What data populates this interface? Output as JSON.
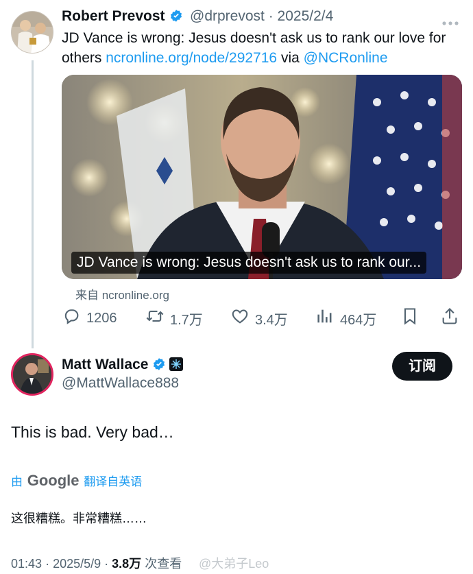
{
  "tweet1": {
    "author_name": "Robert Prevost",
    "handle": "@drprevost",
    "separator": "·",
    "date": "2025/2/4",
    "text_line1": "JD Vance is wrong: Jesus doesn't ask us to rank our love for",
    "text_line2_prefix": "others",
    "link": "ncronline.org/node/292716",
    "via_word": "via",
    "mention": "@NCRonline",
    "media_caption": "JD Vance is wrong: Jesus doesn't ask us to rank our...",
    "from_label": "来自 ncronline.org",
    "stats": {
      "replies": "1206",
      "reposts": "1.7万",
      "likes": "3.4万",
      "views": "464万"
    }
  },
  "tweet2": {
    "author_name": "Matt Wallace",
    "handle": "@MattWallace888",
    "subscribe_label": "订阅",
    "text": "This is bad. Very bad…",
    "translate_prefix": "由",
    "translate_brand": "Google",
    "translate_suffix": "翻译自英语",
    "translation": "这很糟糕。非常糟糕……",
    "time": "01:43",
    "date": "2025/5/9",
    "views_count": "3.8万",
    "views_label": "次查看"
  },
  "watermark": "@大弟子Leo",
  "colors": {
    "accent": "#1d9bf0",
    "text": "#0f1419",
    "muted": "#536471"
  }
}
